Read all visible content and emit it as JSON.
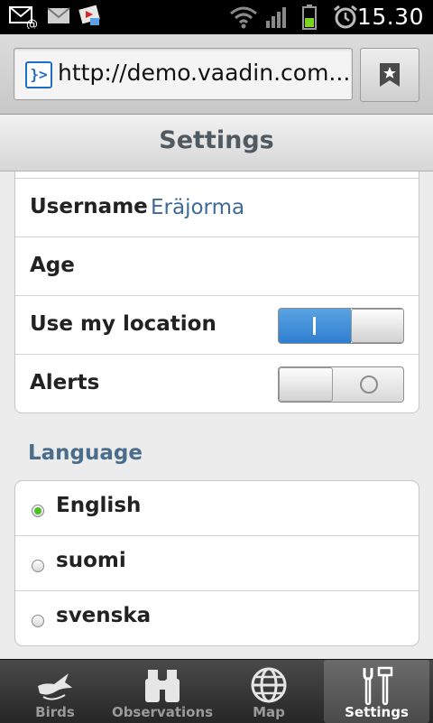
{
  "status_bar": {
    "time": "15.30",
    "icons": [
      "missed-email-icon",
      "gmail-icon",
      "media-notification-icon",
      "wifi-icon",
      "signal-icon",
      "battery-icon",
      "alarm-icon"
    ]
  },
  "browser": {
    "url": "http://demo.vaadin.com...",
    "favicon": "vaadin-icon",
    "bookmark_icon": "bookmark-icon"
  },
  "nav": {
    "title": "Settings"
  },
  "form": {
    "rows": [
      {
        "label": "Username",
        "value": "Eräjorma"
      },
      {
        "label": "Age"
      },
      {
        "label": "Use my location",
        "toggle": true,
        "toggle_mark": "I"
      },
      {
        "label": "Alerts",
        "toggle": false
      }
    ]
  },
  "language": {
    "heading": "Language",
    "options": [
      {
        "label": "English",
        "selected": true
      },
      {
        "label": "suomi",
        "selected": false
      },
      {
        "label": "svenska",
        "selected": false
      }
    ]
  },
  "tabs": [
    {
      "label": "Birds",
      "icon": "bird-icon",
      "active": false
    },
    {
      "label": "Observations",
      "icon": "binoculars-icon",
      "active": false
    },
    {
      "label": "Map",
      "icon": "globe-icon",
      "active": false
    },
    {
      "label": "Settings",
      "icon": "tools-icon",
      "active": true
    }
  ],
  "colors": {
    "accent_blue": "#2f7fcf",
    "link_blue": "#3e6a9a",
    "radio_selected": "#4fbf26",
    "tabbar": "#2e2e2e"
  }
}
